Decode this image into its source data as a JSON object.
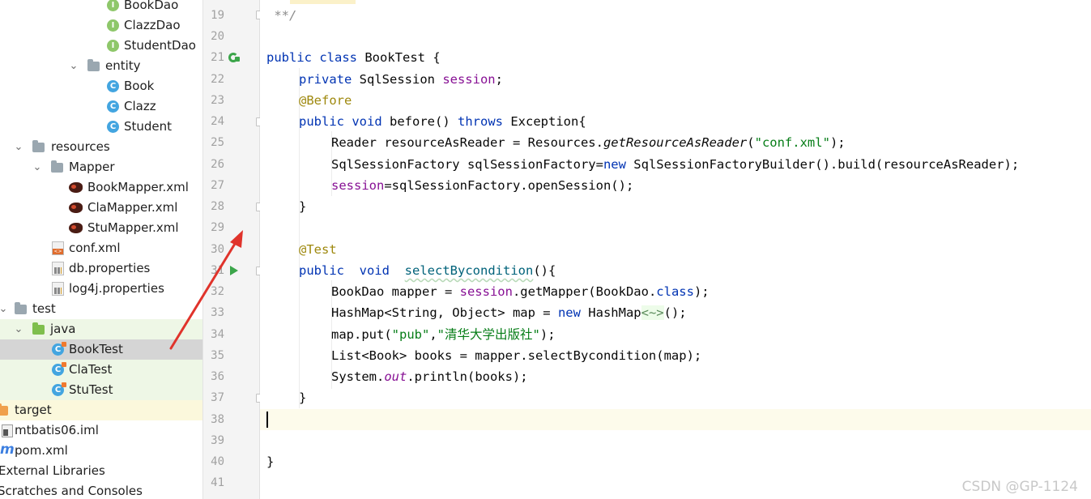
{
  "project_tree": {
    "items": [
      {
        "label": "BookDao",
        "icon": "interface-icon"
      },
      {
        "label": "ClazzDao",
        "icon": "interface-icon"
      },
      {
        "label": "StudentDao",
        "icon": "interface-icon"
      },
      {
        "label": "entity",
        "icon": "package-icon"
      },
      {
        "label": "Book",
        "icon": "class-icon"
      },
      {
        "label": "Clazz",
        "icon": "class-icon"
      },
      {
        "label": "Student",
        "icon": "class-icon"
      },
      {
        "label": "resources",
        "icon": "resources-folder-icon"
      },
      {
        "label": "Mapper",
        "icon": "folder-icon"
      },
      {
        "label": "BookMapper.xml",
        "icon": "mybatis-xml-icon"
      },
      {
        "label": "ClaMapper.xml",
        "icon": "mybatis-xml-icon"
      },
      {
        "label": "StuMapper.xml",
        "icon": "mybatis-xml-icon"
      },
      {
        "label": "conf.xml",
        "icon": "xml-file-icon"
      },
      {
        "label": "db.properties",
        "icon": "properties-file-icon"
      },
      {
        "label": "log4j.properties",
        "icon": "properties-file-icon"
      },
      {
        "label": "test",
        "icon": "folder-icon"
      },
      {
        "label": "java",
        "icon": "test-source-folder-icon"
      },
      {
        "label": "BookTest",
        "icon": "test-class-icon"
      },
      {
        "label": "ClaTest",
        "icon": "test-class-icon"
      },
      {
        "label": "StuTest",
        "icon": "test-class-icon"
      },
      {
        "label": "target",
        "icon": "excluded-folder-icon"
      },
      {
        "label": "mtbatis06.iml",
        "icon": "iml-file-icon"
      },
      {
        "label": "pom.xml",
        "icon": "maven-icon"
      },
      {
        "label": "External Libraries",
        "icon": "libraries-icon"
      },
      {
        "label": "Scratches and Consoles",
        "icon": "scratches-icon"
      }
    ]
  },
  "editor": {
    "line_numbers": [
      "19",
      "20",
      "21",
      "22",
      "23",
      "24",
      "25",
      "26",
      "27",
      "28",
      "29",
      "30",
      "31",
      "32",
      "33",
      "34",
      "35",
      "36",
      "37",
      "38",
      "39",
      "40",
      "41"
    ],
    "code": {
      "l19": " **/",
      "l21_kw1": "public",
      "l21_kw2": "class",
      "l21_rest": " BookTest {",
      "l22_kw": "private",
      "l22_type": " SqlSession ",
      "l22_field": "session",
      "l22_end": ";",
      "l23_ann": "@Before",
      "l24_kw1": "public",
      "l24_kw2": "void",
      "l24_mid": " before() ",
      "l24_kw3": "throws",
      "l24_end": " Exception{",
      "l25_a": "Reader resourceAsReader = Resources.",
      "l25_m": "getResourceAsReader",
      "l25_b": "(",
      "l25_s": "\"conf.xml\"",
      "l25_c": ");",
      "l26_a": "SqlSessionFactory sqlSessionFactory=",
      "l26_kw": "new",
      "l26_b": " SqlSessionFactoryBuilder().build(resourceAsReader);",
      "l27_field": "session",
      "l27_rest": "=sqlSessionFactory.openSession();",
      "l28": "}",
      "l30_ann": "@Test",
      "l31_kw1": "public",
      "l31_kw2": "void",
      "l31_name": "selectBycondition",
      "l31_end": "(){",
      "l32_a": "BookDao mapper = ",
      "l32_field": "session",
      "l32_b": ".getMapper(BookDao.",
      "l32_kw": "class",
      "l32_c": ");",
      "l33_a": "HashMap<String, Object> map = ",
      "l33_kw": "new",
      "l33_b": " HashMap",
      "l33_diam": "<~>",
      "l33_c": "();",
      "l34_a": "map.put(",
      "l34_s1": "\"pub\"",
      "l34_b": ",",
      "l34_s2q1": "\"",
      "l34_s2": "清华大学出版社",
      "l34_s2q2": "\"",
      "l34_c": ");",
      "l35": "List<Book> books = mapper.selectBycondition(map);",
      "l36_a": "System.",
      "l36_field": "out",
      "l36_b": ".println(books);",
      "l37": "}",
      "l40": "}"
    }
  },
  "watermark": "CSDN @GP-1124",
  "colors": {
    "keyword": "#0033b3",
    "field": "#871094",
    "annotation": "#9e880d",
    "string": "#067d17",
    "arrow": "#e0332b",
    "selection": "#d5d5d5"
  }
}
